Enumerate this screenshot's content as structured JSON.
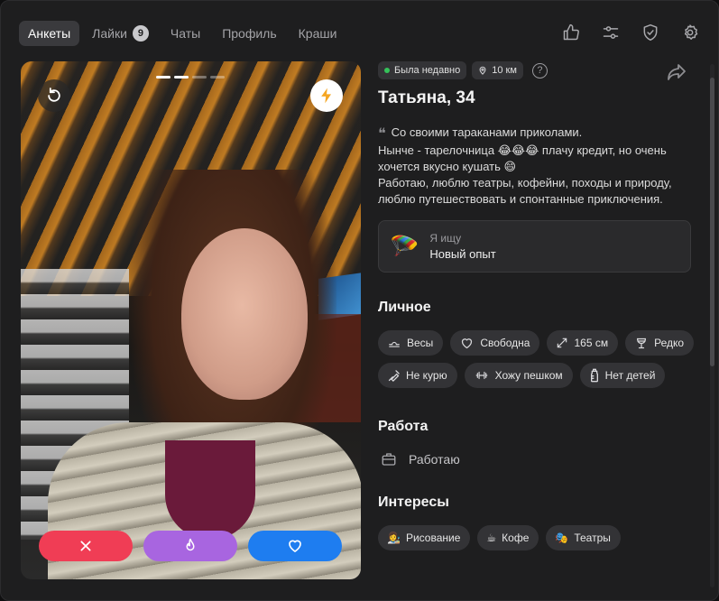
{
  "nav": {
    "tabs": [
      {
        "label": "Анкеты",
        "active": true
      },
      {
        "label": "Лайки",
        "badge": "9"
      },
      {
        "label": "Чаты"
      },
      {
        "label": "Профиль"
      },
      {
        "label": "Краши"
      }
    ],
    "icons": [
      "thumbs-up-icon",
      "sliders-icon",
      "shield-check-icon",
      "gear-icon"
    ]
  },
  "photo": {
    "pages_total": 4,
    "page_current": 2,
    "buttons": [
      "undo-icon",
      "lightning-icon"
    ],
    "actions": [
      "close-icon",
      "fire-icon",
      "heart-icon"
    ],
    "accent_colors": {
      "dislike": "#f03d55",
      "super": "#a865e0",
      "like": "#1e7df0"
    }
  },
  "profile": {
    "status": "Была недавно",
    "distance": "10 км",
    "help": "?",
    "name": "Татьяна, 34",
    "bio": {
      "line1": "Со своими тараканами приколами.",
      "line2": "Нынче - тарелочница 😂😂😂 плачу кредит, но очень хочется вкусно кушать 😄",
      "line3": "Работаю, люблю театры, кофейни, походы и природу, люблю путешествовать и спонтанные приключения."
    },
    "seeking": {
      "label": "Я ищу",
      "value": "Новый опыт",
      "emoji": "🪂"
    }
  },
  "personal": {
    "title": "Личное",
    "chips": [
      {
        "icon": "libra-icon",
        "label": "Весы"
      },
      {
        "icon": "heart-outline-icon",
        "label": "Свободна"
      },
      {
        "icon": "height-arrows-icon",
        "label": "165 см"
      },
      {
        "icon": "wine-glass-icon",
        "label": "Редко"
      },
      {
        "icon": "no-smoking-icon",
        "label": "Не курю"
      },
      {
        "icon": "dumbbell-icon",
        "label": "Хожу пешком"
      },
      {
        "icon": "baby-bottle-icon",
        "label": "Нет детей"
      }
    ]
  },
  "work": {
    "title": "Работа",
    "icon": "briefcase-icon",
    "value": "Работаю"
  },
  "interests": {
    "title": "Интересы",
    "chips": [
      {
        "emoji": "👩‍🎨",
        "label": "Рисование"
      },
      {
        "emoji": "☕",
        "label": "Кофе"
      },
      {
        "emoji": "🎭",
        "label": "Театры"
      }
    ]
  }
}
